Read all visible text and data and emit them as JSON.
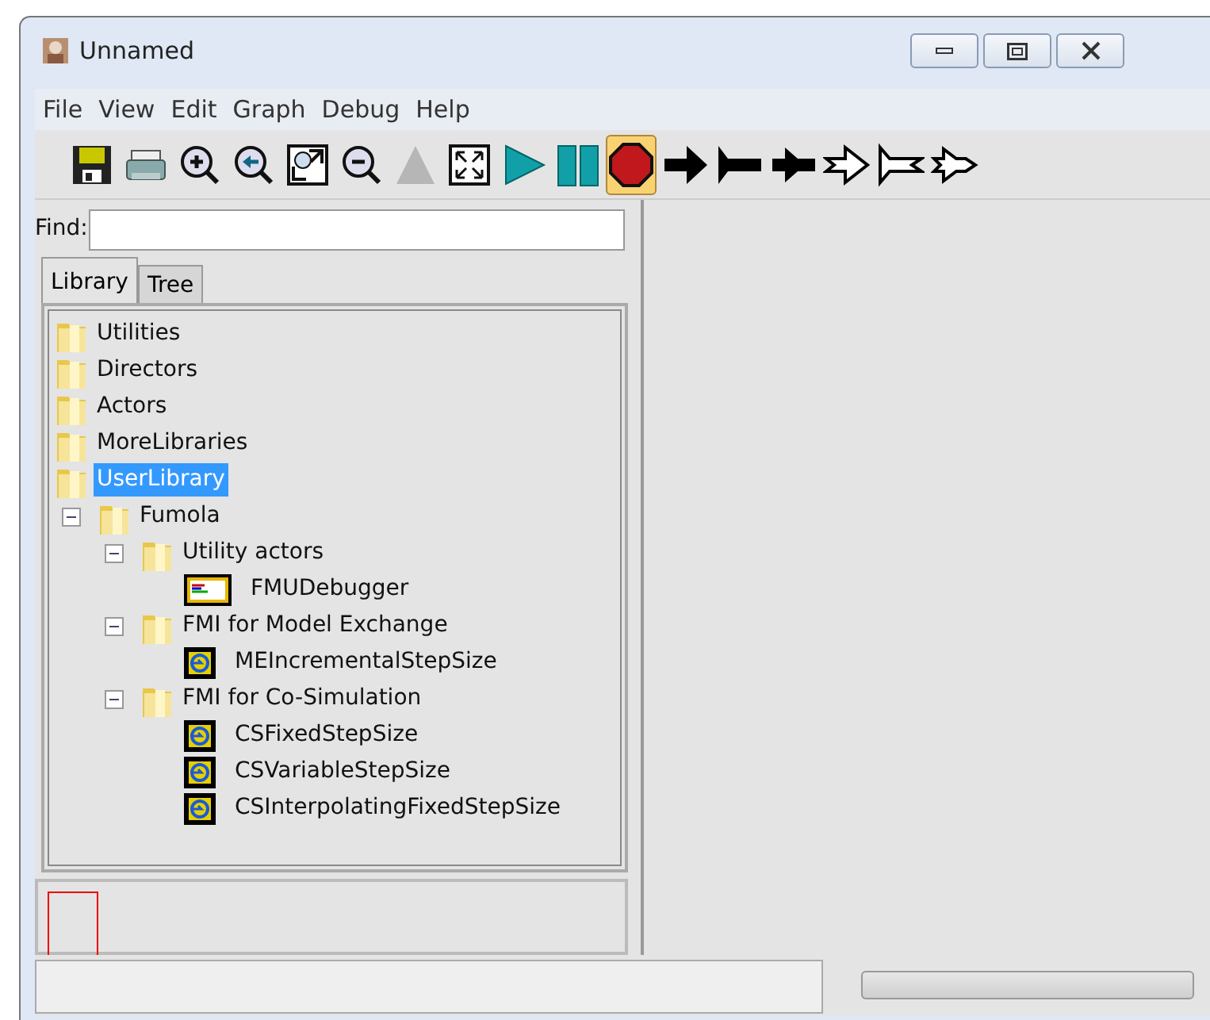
{
  "window": {
    "title": "Unnamed"
  },
  "menu": [
    "File",
    "View",
    "Edit",
    "Graph",
    "Debug",
    "Help"
  ],
  "toolbar": [
    {
      "kind": "save",
      "pressed": false,
      "disabled": false
    },
    {
      "kind": "print",
      "pressed": false,
      "disabled": false
    },
    {
      "kind": "zoom-in",
      "pressed": false,
      "disabled": false
    },
    {
      "kind": "zoom-reset",
      "pressed": false,
      "disabled": false
    },
    {
      "kind": "zoom-fit",
      "pressed": false,
      "disabled": false
    },
    {
      "kind": "zoom-out",
      "pressed": false,
      "disabled": false
    },
    {
      "kind": "up",
      "pressed": false,
      "disabled": true
    },
    {
      "kind": "fullscreen",
      "pressed": false,
      "disabled": false
    },
    {
      "kind": "run",
      "pressed": false,
      "disabled": false
    },
    {
      "kind": "pause",
      "pressed": false,
      "disabled": false
    },
    {
      "kind": "stop",
      "pressed": true,
      "disabled": false
    },
    {
      "kind": "arrow",
      "pressed": false,
      "disabled": false
    },
    {
      "kind": "flag",
      "pressed": false,
      "disabled": false
    },
    {
      "kind": "double",
      "pressed": false,
      "disabled": false
    },
    {
      "kind": "arrow-outline",
      "pressed": false,
      "disabled": false
    },
    {
      "kind": "flag-outline",
      "pressed": false,
      "disabled": false
    },
    {
      "kind": "double-outline",
      "pressed": false,
      "disabled": false
    }
  ],
  "find": {
    "label": "Find:"
  },
  "tabs": [
    {
      "label": "Library",
      "selected": true
    },
    {
      "label": "Tree",
      "selected": false
    }
  ],
  "tree": [
    {
      "label": "Utilities",
      "kind": "folder",
      "selected": false
    },
    {
      "label": "Directors",
      "kind": "folder",
      "selected": false
    },
    {
      "label": "Actors",
      "kind": "folder",
      "selected": false
    },
    {
      "label": "MoreLibraries",
      "kind": "folder",
      "selected": false
    },
    {
      "label": "UserLibrary",
      "kind": "folder",
      "selected": true,
      "children": [
        {
          "label": "Fumola",
          "kind": "folder",
          "selected": false,
          "expanded": true,
          "children": [
            {
              "label": "Utility actors",
              "kind": "folder",
              "selected": false,
              "expanded": true,
              "children": [
                {
                  "label": "FMUDebugger",
                  "kind": "debugger",
                  "selected": false
                }
              ]
            },
            {
              "label": "FMI for Model Exchange",
              "kind": "folder",
              "selected": false,
              "expanded": true,
              "children": [
                {
                  "label": "MEIncrementalStepSize",
                  "kind": "fmu",
                  "selected": false
                }
              ]
            },
            {
              "label": "FMI for Co-Simulation",
              "kind": "folder",
              "selected": false,
              "expanded": true,
              "children": [
                {
                  "label": "CSFixedStepSize",
                  "kind": "fmu",
                  "selected": false
                },
                {
                  "label": "CSVariableStepSize",
                  "kind": "fmu",
                  "selected": false
                },
                {
                  "label": "CSInterpolatingFixedStepSize",
                  "kind": "fmu",
                  "selected": false
                }
              ]
            }
          ]
        }
      ]
    }
  ],
  "status_bar": {
    "progress": {
      "level": 0
    }
  }
}
